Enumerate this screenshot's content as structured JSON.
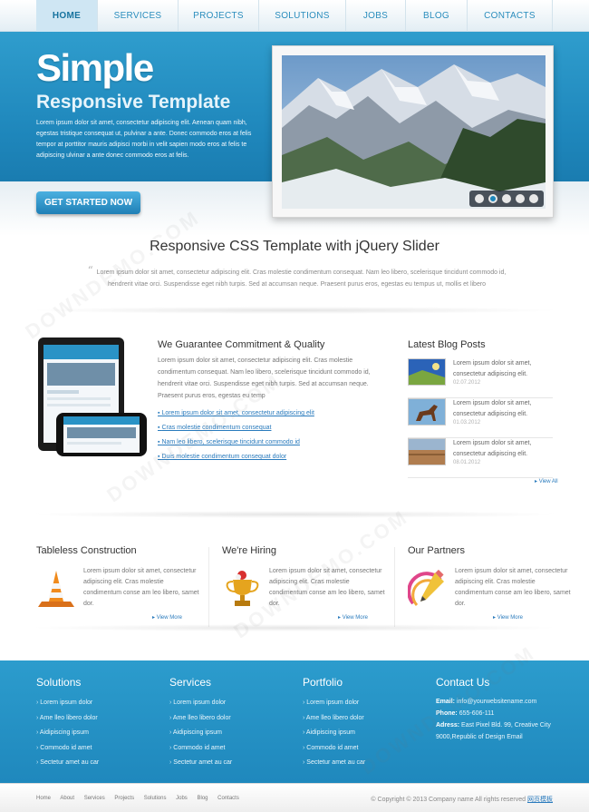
{
  "nav": {
    "items": [
      {
        "label": "HOME",
        "active": true
      },
      {
        "label": "SERVICES"
      },
      {
        "label": "PROJECTS"
      },
      {
        "label": "SOLUTIONS"
      },
      {
        "label": "JOBS"
      },
      {
        "label": "BLOG"
      },
      {
        "label": "CONTACTS"
      }
    ]
  },
  "hero": {
    "title": "Simple",
    "subtitle": "Responsive Template",
    "text": "Lorem ipsum dolor sit amet, consectetur adipiscing elit. Aenean quam nibh, egestas tristique consequat ut, pulvinar a ante. Donec commodo eros at felis tempor at porttitor mauris adipisci morbi in velit sapien modo eros at felis te adipiscing ulvinar a ante donec commodo eros at felis.",
    "cta_label": "GET STARTED NOW",
    "slider_active_index": 1,
    "slider_count": 5
  },
  "intro": {
    "title": "Responsive CSS Template with jQuery Slider",
    "text": "Lorem ipsum dolor sit amet, consectetur adipiscing elit. Cras molestie condimentum consequat. Nam leo libero, scelerisque tincidunt commodo id, hendrerit vitae orci. Suspendisse eget nibh turpis. Sed at accumsan neque. Praesent purus eros, egestas eu tempus ut, mollis et libero"
  },
  "guarantee": {
    "title": "We Guarantee Commitment & Quality",
    "text": "Lorem ipsum dolor sit amet, consectetur adipiscing elit. Cras molestie condimentum consequat. Nam leo libero, scelerisque tincidunt commodo id, hendrerit vitae orci. Suspendisse eget nibh turpis. Sed at accumsan neque. Praesent purus eros, egestas eu temp",
    "links": [
      "Lorem ipsum dolor sit amet, consectetur adipiscing elit",
      "Cras molestie condimentum consequat",
      "Nam leo libero, scelerisque tincidunt commodo id",
      "Duis molestie condimentum consequat dolor"
    ]
  },
  "blog": {
    "title": "Latest Blog Posts",
    "posts": [
      {
        "text": "Lorem ipsum dolor sit amet, consectetur adipiscing elit.",
        "date": "02.07.2012"
      },
      {
        "text": "Lorem ipsum dolor sit amet, consectetur adipiscing elit.",
        "date": "01.03.2012"
      },
      {
        "text": "Lorem ipsum dolor sit amet, consectetur adipiscing elit.",
        "date": "08.01.2012"
      }
    ],
    "view_all": "View All"
  },
  "columns": [
    {
      "title": "Tableless Construction",
      "text": "Lorem ipsum dolor sit amet, consectetur adipiscing elit. Cras molestie condimentum conse am leo libero, samet dor.",
      "more": "View More"
    },
    {
      "title": "We're Hiring",
      "text": "Lorem ipsum dolor sit amet, consectetur adipiscing elit. Cras molestie condimentum conse am leo libero, samet dor.",
      "more": "View More"
    },
    {
      "title": "Our Partners",
      "text": "Lorem ipsum dolor sit amet, consectetur adipiscing elit. Cras molestie condimentum conse am leo libero, samet dor.",
      "more": "View More"
    }
  ],
  "footer": {
    "solutions": {
      "title": "Solutions",
      "items": [
        "Lorem ipsum dolor",
        "Ame lleo libero dolor",
        "Aidipiscing ipsum",
        "Commodo id amet",
        "Sectetur amet au car"
      ]
    },
    "services": {
      "title": "Services",
      "items": [
        "Lorem ipsum dolor",
        "Ame lleo libero dolor",
        "Aidipiscing ipsum",
        "Commodo id amet",
        "Sectetur amet au car"
      ]
    },
    "portfolio": {
      "title": "Portfolio",
      "items": [
        "Lorem ipsum dolor",
        "Ame lleo libero dolor",
        "Aidipiscing ipsum",
        "Commodo id amet",
        "Sectetur amet au car"
      ]
    },
    "contact": {
      "title": "Contact Us",
      "email_label": "Email:",
      "email": "info@yourwebsitename.com",
      "phone_label": "Phone:",
      "phone": "655-606-111",
      "address_label": "Adress:",
      "address": "East Pixel Bld. 99, Creative City 9000,Republic of Design Email"
    }
  },
  "bottom": {
    "links": [
      "Home",
      "About",
      "Services",
      "Projects",
      "Solutions",
      "Jobs",
      "Blog",
      "Contacts"
    ],
    "copyright": "© Copyright © 2013 Company name All rights reserved",
    "brand": "网页模板"
  },
  "watermark": "DOWNDEMO.COM",
  "colors": {
    "accent": "#1e86bb",
    "link": "#2a7bbd"
  }
}
